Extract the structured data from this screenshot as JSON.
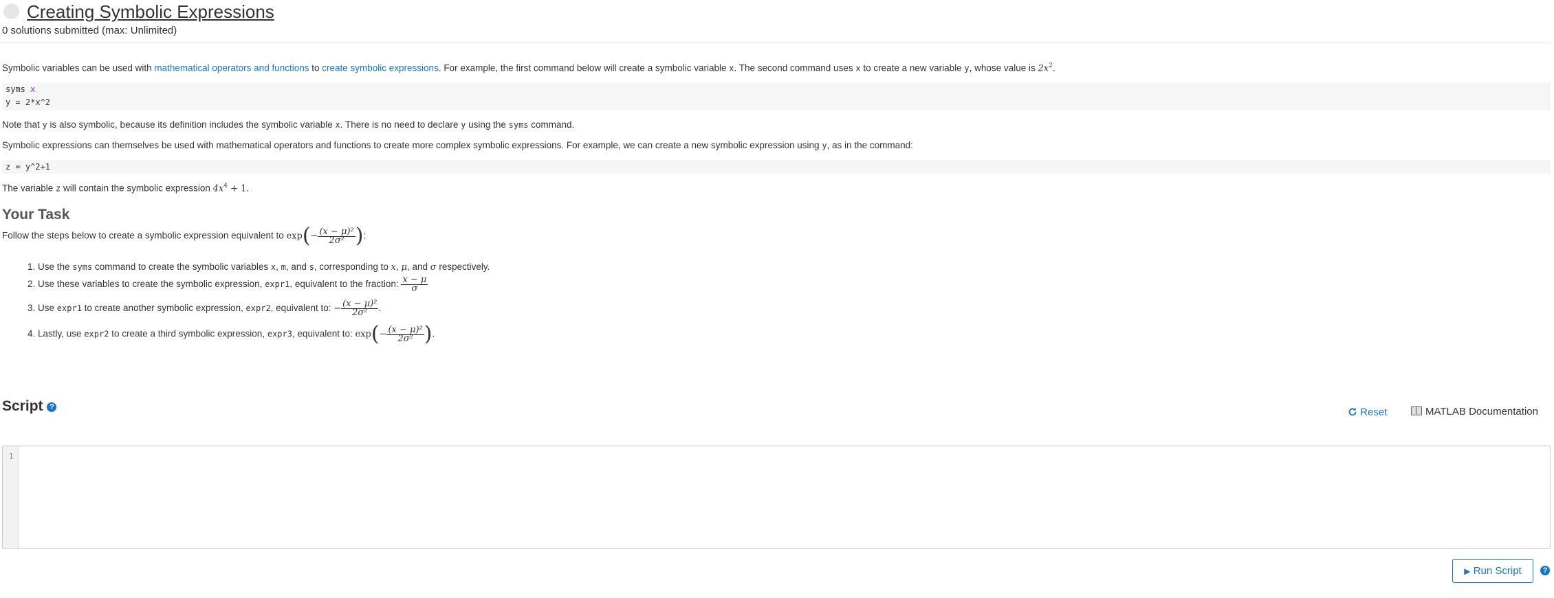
{
  "header": {
    "title": "Creating Symbolic Expressions",
    "submissions": "0 solutions submitted (max: Unlimited)"
  },
  "intro": {
    "t1": "Symbolic variables can be used with ",
    "link1": "mathematical operators and functions",
    "t2": " to ",
    "link2": "create symbolic expressions",
    "t3": ". For example, the first command below will create a symbolic variable ",
    "c1": "x",
    "t4": ". The second command uses ",
    "c2": "x",
    "t5": " to create a new variable ",
    "c3": "y",
    "t6": ", whose value is ",
    "m1": "2x",
    "m1sup": "2",
    "t7": "."
  },
  "code1": {
    "line1_kw": "syms",
    "line1_arg": "x",
    "line2": "y = 2*x^2"
  },
  "note1": {
    "t1": "Note that ",
    "c1": "y",
    "t2": " is also symbolic, because its definition includes the symbolic variable ",
    "c2": "x",
    "t3": ". There is no need to declare ",
    "c3": "y",
    "t4": " using the ",
    "c4": "syms",
    "t5": " command."
  },
  "note2": {
    "t1": "Symbolic expressions can themselves be used with mathematical operators and functions to create more complex symbolic expressions. For example, we can create a new symbolic expression using ",
    "c1": "y",
    "t2": ", as in the command:"
  },
  "code2": {
    "line1": "z = y^2+1"
  },
  "note3": {
    "t1": "The variable ",
    "c1": "z",
    "t2": " will contain the symbolic expression ",
    "m1": "4x",
    "m1sup": "4",
    "m2": " + 1",
    "t3": "."
  },
  "task": {
    "heading": "Your Task",
    "intro": "Follow the steps below to create a symbolic expression equivalent to ",
    "exp": "exp",
    "minus": "−",
    "frac_num": "(x − μ)²",
    "frac_den": "2σ²",
    "colon": ":",
    "steps": [
      {
        "n": "1.",
        "t1": "Use the ",
        "c1": "syms",
        "t2": " command to create the symbolic variables ",
        "c2": "x",
        "t3": ", ",
        "c3": "m",
        "t4": ", and ",
        "c4": "s",
        "t5": ", corresponding to ",
        "m1": "x",
        "t6": ", ",
        "m2": "μ",
        "t7": ", and ",
        "m3": "σ",
        "t8": " respectively."
      },
      {
        "n": "2.",
        "t1": "Use these variables to create the symbolic expression, ",
        "c1": "expr1",
        "t2": ", equivalent to the fraction: ",
        "frac_num": "x − μ",
        "frac_den": "σ"
      },
      {
        "n": "3.",
        "t1": "Use ",
        "c1": "expr1",
        "t2": " to create another symbolic expression, ",
        "c2": "expr2",
        "t3": ", equivalent to: ",
        "minus": "−",
        "frac_num": "(x − μ)²",
        "frac_den": "2σ²",
        "end": "."
      },
      {
        "n": "4.",
        "t1": "Lastly, use ",
        "c1": "expr2",
        "t2": " to create a third symbolic expression, ",
        "c2": "expr3",
        "t3": ", equivalent to: ",
        "exp": "exp",
        "minus": "−",
        "frac_num": "(x − μ)²",
        "frac_den": "2σ²",
        "end": "."
      }
    ]
  },
  "script": {
    "title": "Script",
    "help": "?",
    "reset": "Reset",
    "docs": "MATLAB Documentation",
    "line_number": "1",
    "run": "Run Script"
  },
  "colors": {
    "link": "#1a73c9",
    "keyword": "#a020f0"
  },
  "icons": [
    "status-circle-icon",
    "help-icon",
    "reset-icon",
    "book-icon",
    "play-icon"
  ]
}
